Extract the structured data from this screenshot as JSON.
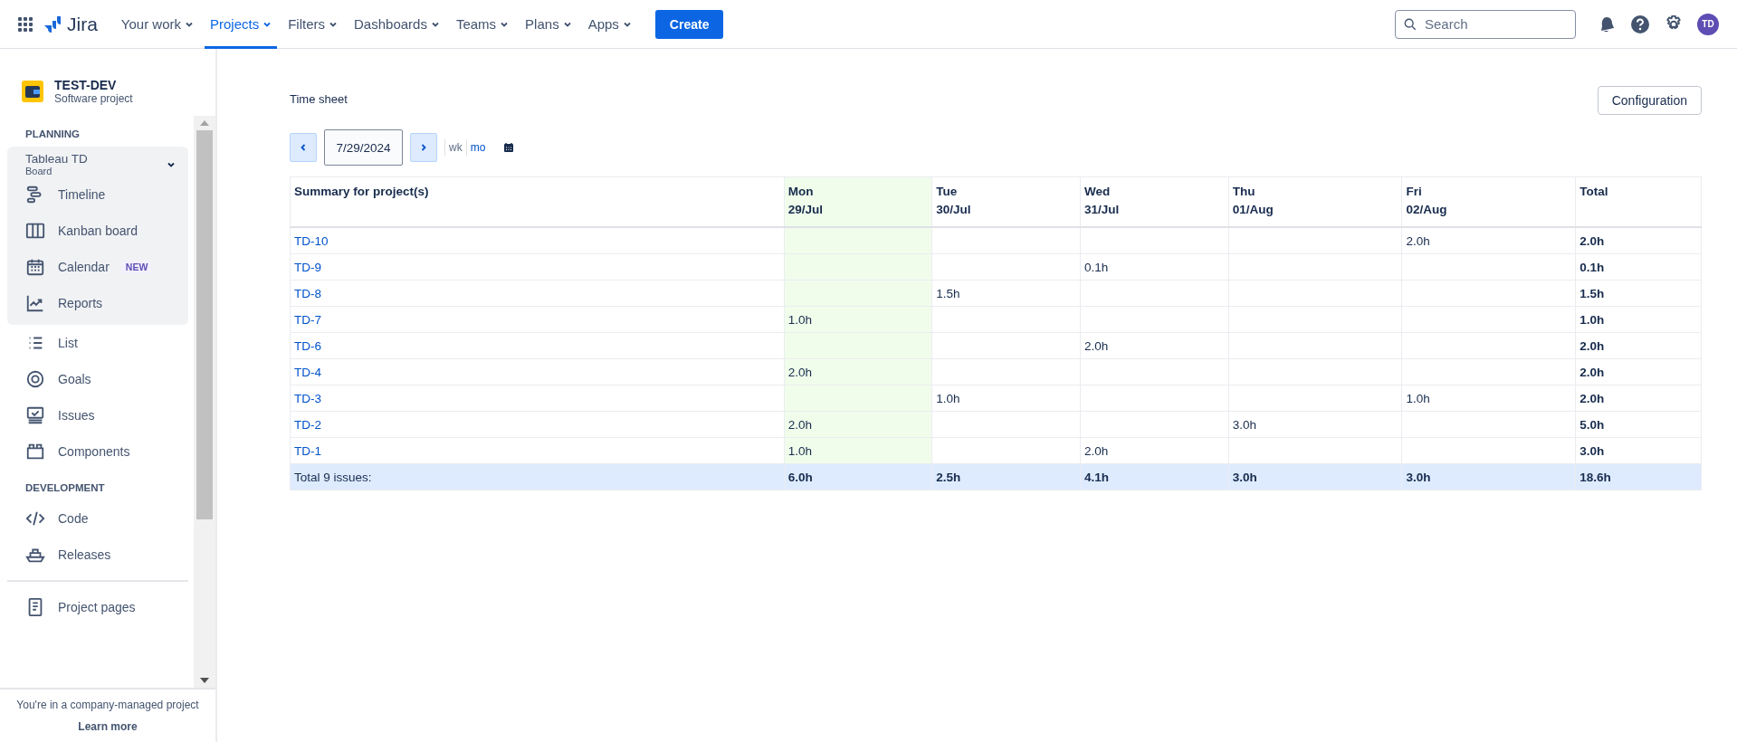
{
  "topbar": {
    "product": "Jira",
    "nav": [
      {
        "label": "Your work",
        "selected": false
      },
      {
        "label": "Projects",
        "selected": true
      },
      {
        "label": "Filters",
        "selected": false
      },
      {
        "label": "Dashboards",
        "selected": false
      },
      {
        "label": "Teams",
        "selected": false
      },
      {
        "label": "Plans",
        "selected": false
      },
      {
        "label": "Apps",
        "selected": false
      }
    ],
    "create": "Create",
    "search": {
      "placeholder": "Search"
    },
    "avatar": "TD"
  },
  "sidebar": {
    "project": {
      "name": "TEST-DEV",
      "type": "Software project"
    },
    "sections": [
      {
        "title": "PLANNING",
        "board": {
          "name": "Tableau TD",
          "sub": "Board",
          "expanded": true,
          "items": [
            {
              "label": "Timeline"
            },
            {
              "label": "Kanban board"
            },
            {
              "label": "Calendar",
              "badge": "NEW"
            },
            {
              "label": "Reports"
            }
          ]
        },
        "items": [
          {
            "label": "List"
          },
          {
            "label": "Goals"
          },
          {
            "label": "Issues"
          },
          {
            "label": "Components"
          }
        ]
      },
      {
        "title": "DEVELOPMENT",
        "items": [
          {
            "label": "Code"
          },
          {
            "label": "Releases"
          }
        ]
      }
    ],
    "pages": {
      "label": "Project pages"
    },
    "footer": {
      "text": "You're in a company-managed project",
      "link": "Learn more"
    }
  },
  "main": {
    "title": "Time sheet",
    "configuration": "Configuration",
    "date": "7/29/2024",
    "views": [
      "wk",
      "mo"
    ],
    "table": {
      "columns": [
        {
          "day": "Summary for project(s)",
          "today": false
        },
        {
          "day": "Mon",
          "date": "29/Jul",
          "today": true
        },
        {
          "day": "Tue",
          "date": "30/Jul",
          "today": false
        },
        {
          "day": "Wed",
          "date": "31/Jul",
          "today": false
        },
        {
          "day": "Thu",
          "date": "01/Aug",
          "today": false
        },
        {
          "day": "Fri",
          "date": "02/Aug",
          "today": false
        },
        {
          "day": "Total",
          "today": false
        }
      ],
      "rows": [
        {
          "cells": [
            "TD-10",
            "",
            "",
            "",
            "",
            "2.0h",
            "2.0h"
          ]
        },
        {
          "cells": [
            "TD-9",
            "",
            "",
            "0.1h",
            "",
            "",
            "0.1h"
          ]
        },
        {
          "cells": [
            "TD-8",
            "",
            "1.5h",
            "",
            "",
            "",
            "1.5h"
          ]
        },
        {
          "cells": [
            "TD-7",
            "1.0h",
            "",
            "",
            "",
            "",
            "1.0h"
          ]
        },
        {
          "cells": [
            "TD-6",
            "",
            "",
            "2.0h",
            "",
            "",
            "2.0h"
          ]
        },
        {
          "cells": [
            "TD-4",
            "2.0h",
            "",
            "",
            "",
            "",
            "2.0h"
          ]
        },
        {
          "cells": [
            "TD-3",
            "",
            "1.0h",
            "",
            "",
            "1.0h",
            "2.0h"
          ]
        },
        {
          "cells": [
            "TD-2",
            "2.0h",
            "",
            "",
            "3.0h",
            "",
            "5.0h"
          ]
        },
        {
          "cells": [
            "TD-1",
            "1.0h",
            "",
            "2.0h",
            "",
            "",
            "3.0h"
          ]
        }
      ],
      "footer": {
        "cells": [
          "Total 9 issues:",
          "6.0h",
          "2.5h",
          "4.1h",
          "3.0h",
          "3.0h",
          "18.6h"
        ]
      }
    }
  }
}
